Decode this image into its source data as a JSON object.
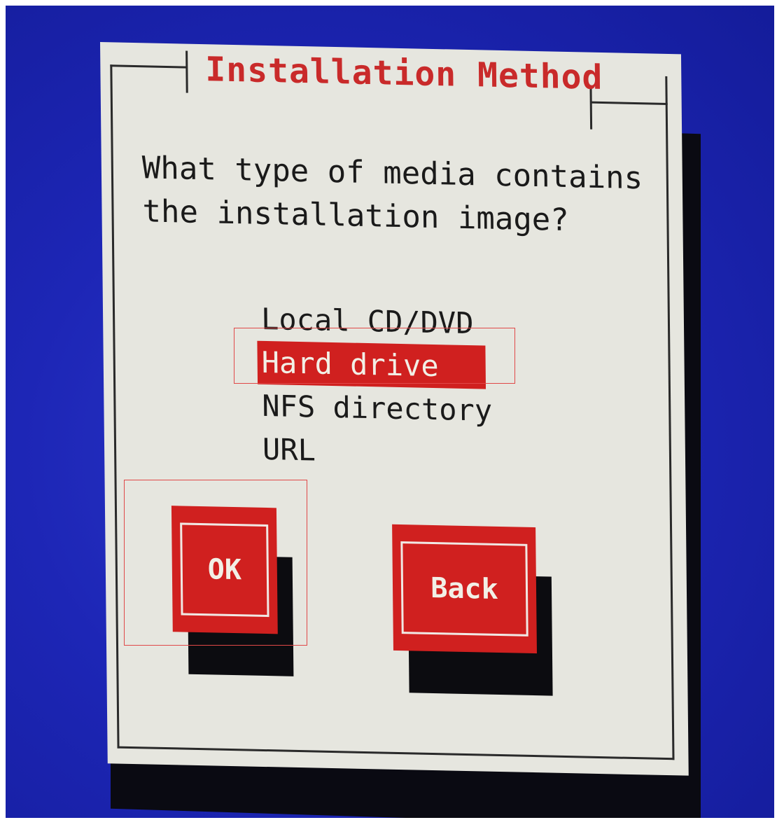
{
  "dialog": {
    "title": "Installation Method",
    "prompt": "What type of media contains\nthe installation image?"
  },
  "options": [
    {
      "label": "Local CD/DVD",
      "selected": false
    },
    {
      "label": "Hard drive",
      "selected": true
    },
    {
      "label": "NFS directory",
      "selected": false
    },
    {
      "label": "URL",
      "selected": false
    }
  ],
  "buttons": {
    "ok_label": "OK",
    "back_label": "Back"
  },
  "colors": {
    "background": "#1d26b6",
    "dialog": "#e6e6df",
    "accent": "#d0201f",
    "highlight_outline": "#e04848"
  }
}
